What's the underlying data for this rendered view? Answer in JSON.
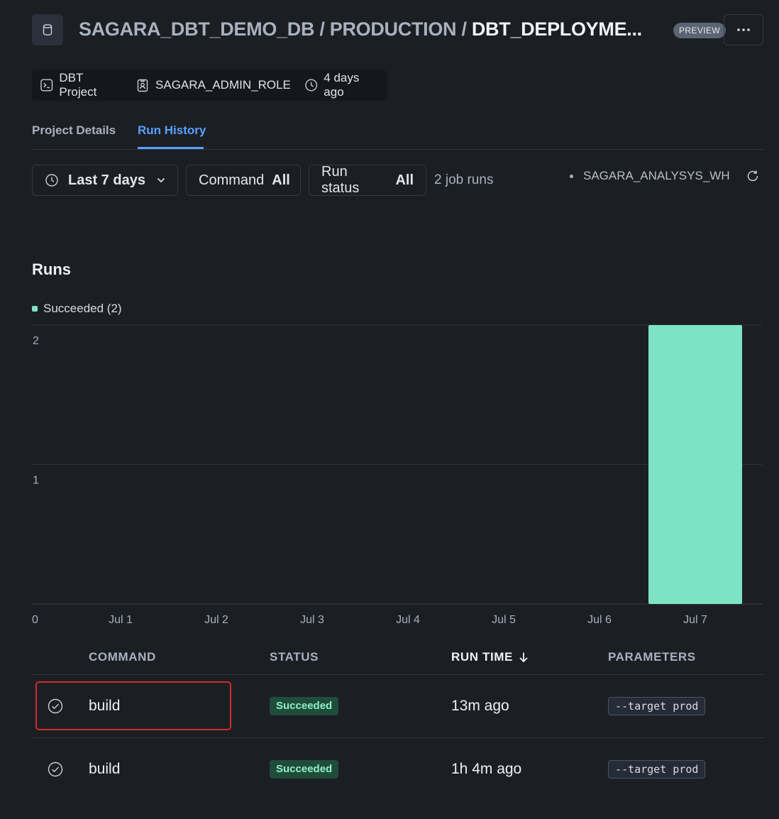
{
  "header": {
    "breadcrumb": [
      "SAGARA_DBT_DEMO_DB",
      "PRODUCTION"
    ],
    "separator": "/",
    "current": "DBT_DEPLOYME...",
    "badge": "PREVIEW"
  },
  "meta": {
    "type": "DBT Project",
    "role": "SAGARA_ADMIN_ROLE",
    "updated": "4 days ago"
  },
  "tabs": [
    {
      "label": "Project Details",
      "active": false
    },
    {
      "label": "Run History",
      "active": true
    }
  ],
  "filters": {
    "range_label": "Last 7 days",
    "command_label": "Command",
    "command_value": "All",
    "status_label": "Run status",
    "status_value": "All",
    "job_count": "2 job runs",
    "warehouse": "SAGARA_ANALYSYS_WH"
  },
  "section_title": "Runs",
  "legend": "Succeeded (2)",
  "chart_data": {
    "type": "bar",
    "categories": [
      "Jul 1",
      "Jul 2",
      "Jul 3",
      "Jul 4",
      "Jul 5",
      "Jul 6",
      "Jul 7"
    ],
    "series": [
      {
        "name": "Succeeded",
        "values": [
          0,
          0,
          0,
          0,
          0,
          0,
          2
        ],
        "color": "#7ee3c2"
      }
    ],
    "y_ticks": [
      "0",
      "1",
      "2"
    ],
    "ylim": [
      0,
      2
    ],
    "grid": true
  },
  "table": {
    "columns": [
      "COMMAND",
      "STATUS",
      "RUN TIME",
      "PARAMETERS"
    ],
    "sorted_column": "RUN TIME",
    "rows": [
      {
        "command": "build",
        "status": "Succeeded",
        "run_time": "13m ago",
        "parameters": "--target prod"
      },
      {
        "command": "build",
        "status": "Succeeded",
        "run_time": "1h 4m ago",
        "parameters": "--target prod"
      }
    ]
  },
  "colors": {
    "accent": "#5aa0ff",
    "success": "#7ee3c2",
    "highlight": "#d42a2a"
  }
}
